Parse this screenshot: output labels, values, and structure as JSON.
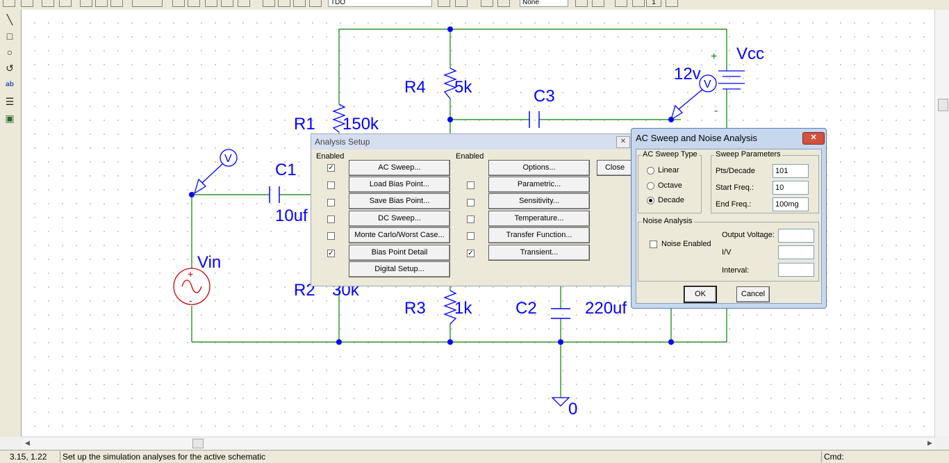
{
  "schematic": {
    "components": {
      "r4": {
        "name": "R4",
        "value": "5k"
      },
      "c3": {
        "name": "C3"
      },
      "vcc": {
        "name": "Vcc",
        "value": "12v",
        "plus": "+",
        "minus": "-"
      },
      "r1": {
        "name": "R1",
        "value": "150k"
      },
      "c1": {
        "name": "C1",
        "value": "10uf"
      },
      "vin": {
        "name": "Vin",
        "plus": "+",
        "minus": "-"
      },
      "r2": {
        "name": "R2",
        "value": "30k"
      },
      "r3": {
        "name": "R3",
        "value": "1k"
      },
      "c2": {
        "name": "C2",
        "value": "220uf"
      },
      "ground": {
        "name": "0"
      }
    },
    "probe_label": "V"
  },
  "analysis_setup": {
    "title": "Analysis Setup",
    "enabled_header": "Enabled",
    "close_label": "Close",
    "left_items": [
      {
        "label": "AC Sweep...",
        "checked": true
      },
      {
        "label": "Load Bias Point...",
        "checked": false
      },
      {
        "label": "Save Bias Point...",
        "checked": false
      },
      {
        "label": "DC Sweep...",
        "checked": false
      },
      {
        "label": "Monte Carlo/Worst Case...",
        "checked": false
      },
      {
        "label": "Bias Point Detail",
        "checked": true
      }
    ],
    "digital_setup_label": "Digital Setup...",
    "right_items": [
      {
        "label": "Options...",
        "has_checkbox": false,
        "checked": false
      },
      {
        "label": "Parametric...",
        "has_checkbox": true,
        "checked": false
      },
      {
        "label": "Sensitivity...",
        "has_checkbox": true,
        "checked": false
      },
      {
        "label": "Temperature...",
        "has_checkbox": true,
        "checked": false
      },
      {
        "label": "Transfer Function...",
        "has_checkbox": true,
        "checked": false
      },
      {
        "label": "Transient...",
        "has_checkbox": true,
        "checked": true
      }
    ]
  },
  "ac_dialog": {
    "title": "AC Sweep and Noise Analysis",
    "sweep_type": {
      "label": "AC Sweep Type",
      "options": [
        {
          "label": "Linear",
          "selected": false
        },
        {
          "label": "Octave",
          "selected": false
        },
        {
          "label": "Decade",
          "selected": true
        }
      ]
    },
    "sweep_params": {
      "label": "Sweep Parameters",
      "fields": [
        {
          "label": "Pts/Decade",
          "value": "101"
        },
        {
          "label": "Start Freq.:",
          "value": "10"
        },
        {
          "label": "End Freq.:",
          "value": "100mg"
        }
      ]
    },
    "noise": {
      "label": "Noise Analysis",
      "enabled_label": "Noise Enabled",
      "enabled": false,
      "fields": [
        {
          "label": "Output Voltage:",
          "value": ""
        },
        {
          "label": "I/V",
          "value": ""
        },
        {
          "label": "Interval:",
          "value": ""
        }
      ]
    },
    "ok_label": "OK",
    "cancel_label": "Cancel"
  },
  "toolbar": {
    "part_combo": "TDO",
    "display_combo": "None",
    "digit": "1"
  },
  "status": {
    "coords": "3.15,  1.22",
    "message": "Set up the simulation analyses for the active schematic",
    "cmd_label": "Cmd:"
  },
  "colors": {
    "wire": "#008000",
    "component": "#0000ff",
    "label": "#0000ff",
    "source": "#cc0000"
  },
  "icons": {
    "checkmark": "✓",
    "close": "✕"
  }
}
